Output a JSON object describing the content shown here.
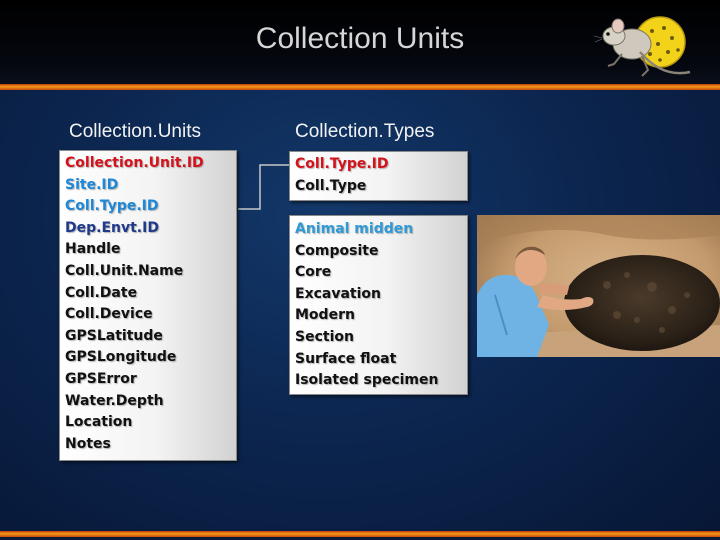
{
  "slide": {
    "title": "Collection Units"
  },
  "tables": {
    "collection_units": {
      "header": "Collection.Units",
      "fields": [
        "Collection.Unit.ID",
        "Site.ID",
        "Coll.Type.ID",
        "Dep.Envt.ID",
        "Handle",
        "Coll.Unit.Name",
        "Coll.Date",
        "Coll.Device",
        "GPSLatitude",
        "GPSLongitude",
        "GPSError",
        "Water.Depth",
        "Location",
        "Notes"
      ]
    },
    "collection_types": {
      "header": "Collection.Types",
      "fields": [
        "Coll.Type.ID",
        "Coll.Type"
      ]
    },
    "collection_type_values": {
      "items": [
        "Animal midden",
        "Composite",
        "Core",
        "Excavation",
        "Modern",
        "Section",
        "Surface float",
        "Isolated specimen"
      ]
    }
  },
  "colors": {
    "primary_key": "#d4121c",
    "foreign_key": "#1e88d8",
    "foreign_key_alt": "#1f3a8a",
    "highlight_value": "#2e9ad6",
    "accent_stripe": "#f29a18"
  },
  "icons": {
    "logo": "packrat-logo-icon"
  }
}
